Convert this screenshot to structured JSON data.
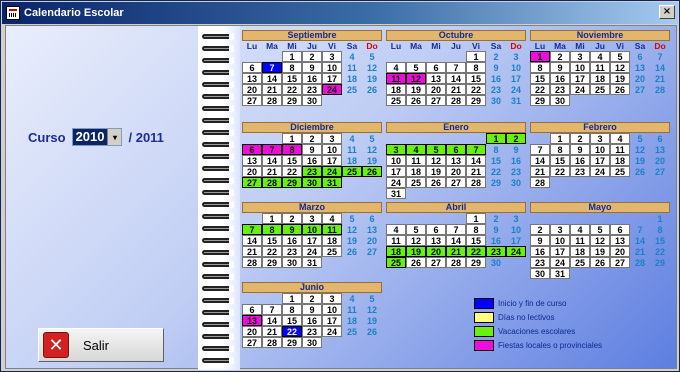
{
  "window": {
    "title": "Calendario Escolar",
    "close_glyph": "×"
  },
  "curso": {
    "label": "Curso",
    "selected": "2010",
    "suffix": "/ 2011",
    "arrow": "▾"
  },
  "salir": {
    "label": "Salir",
    "icon_glyph": "✕"
  },
  "colors": {
    "inicio_fin": "#0000ff",
    "no_lectivo": "#ffff80",
    "vacaciones": "#66f20c",
    "fiestas": "#f20cd9",
    "weekend_text": "#1a80c9"
  },
  "dow": [
    "Lu",
    "Ma",
    "Mi",
    "Ju",
    "Vi",
    "Sa",
    "Do"
  ],
  "months": [
    {
      "name": "Septiembre",
      "weeks": [
        [
          null,
          null,
          "1",
          "2",
          "3",
          "4",
          "5"
        ],
        [
          "6",
          "7",
          "8",
          "9",
          "10",
          "11",
          "12"
        ],
        [
          "13",
          "14",
          "15",
          "16",
          "17",
          "18",
          "19"
        ],
        [
          "20",
          "21",
          "22",
          "23",
          "24",
          "25",
          "26"
        ],
        [
          "27",
          "28",
          "29",
          "30",
          null,
          null,
          null
        ]
      ],
      "blue": [
        "7"
      ],
      "green": [],
      "pink": [
        "24"
      ]
    },
    {
      "name": "Octubre",
      "weeks": [
        [
          null,
          null,
          null,
          null,
          "1",
          "2",
          "3"
        ],
        [
          "4",
          "5",
          "6",
          "7",
          "8",
          "9",
          "10"
        ],
        [
          "11",
          "12",
          "13",
          "14",
          "15",
          "16",
          "17"
        ],
        [
          "18",
          "19",
          "20",
          "21",
          "22",
          "23",
          "24"
        ],
        [
          "25",
          "26",
          "27",
          "28",
          "29",
          "30",
          "31"
        ]
      ],
      "blue": [],
      "green": [],
      "pink": [
        "11",
        "12"
      ]
    },
    {
      "name": "Noviembre",
      "weeks": [
        [
          "1",
          "2",
          "3",
          "4",
          "5",
          "6",
          "7"
        ],
        [
          "8",
          "9",
          "10",
          "11",
          "12",
          "13",
          "14"
        ],
        [
          "15",
          "16",
          "17",
          "18",
          "19",
          "20",
          "21"
        ],
        [
          "22",
          "23",
          "24",
          "25",
          "26",
          "27",
          "28"
        ],
        [
          "29",
          "30",
          null,
          null,
          null,
          null,
          null
        ]
      ],
      "blue": [],
      "green": [],
      "pink": [
        "1"
      ]
    },
    {
      "name": "Diciembre",
      "weeks": [
        [
          null,
          null,
          "1",
          "2",
          "3",
          "4",
          "5"
        ],
        [
          "6",
          "7",
          "8",
          "9",
          "10",
          "11",
          "12"
        ],
        [
          "13",
          "14",
          "15",
          "16",
          "17",
          "18",
          "19"
        ],
        [
          "20",
          "21",
          "22",
          "23",
          "24",
          "25",
          "26"
        ],
        [
          "27",
          "28",
          "29",
          "30",
          "31",
          null,
          null
        ]
      ],
      "blue": [],
      "green": [
        "23",
        "24",
        "25",
        "26",
        "27",
        "28",
        "29",
        "30",
        "31"
      ],
      "pink": [
        "6",
        "7",
        "8"
      ]
    },
    {
      "name": "Enero",
      "weeks": [
        [
          null,
          null,
          null,
          null,
          null,
          "1",
          "2"
        ],
        [
          "3",
          "4",
          "5",
          "6",
          "7",
          "8",
          "9"
        ],
        [
          "10",
          "11",
          "12",
          "13",
          "14",
          "15",
          "16"
        ],
        [
          "17",
          "18",
          "19",
          "20",
          "21",
          "22",
          "23"
        ],
        [
          "24",
          "25",
          "26",
          "27",
          "28",
          "29",
          "30"
        ],
        [
          "31",
          null,
          null,
          null,
          null,
          null,
          null
        ]
      ],
      "blue": [],
      "green": [
        "1",
        "2",
        "3",
        "4",
        "5",
        "6",
        "7"
      ],
      "pink": []
    },
    {
      "name": "Febrero",
      "weeks": [
        [
          null,
          "1",
          "2",
          "3",
          "4",
          "5",
          "6"
        ],
        [
          "7",
          "8",
          "9",
          "10",
          "11",
          "12",
          "13"
        ],
        [
          "14",
          "15",
          "16",
          "17",
          "18",
          "19",
          "20"
        ],
        [
          "21",
          "22",
          "23",
          "24",
          "25",
          "26",
          "27"
        ],
        [
          "28",
          null,
          null,
          null,
          null,
          null,
          null
        ]
      ],
      "blue": [],
      "green": [],
      "pink": []
    },
    {
      "name": "Marzo",
      "weeks": [
        [
          null,
          "1",
          "2",
          "3",
          "4",
          "5",
          "6"
        ],
        [
          "7",
          "8",
          "9",
          "10",
          "11",
          "12",
          "13"
        ],
        [
          "14",
          "15",
          "16",
          "17",
          "18",
          "19",
          "20"
        ],
        [
          "21",
          "22",
          "23",
          "24",
          "25",
          "26",
          "27"
        ],
        [
          "28",
          "29",
          "30",
          "31",
          null,
          null,
          null
        ]
      ],
      "blue": [],
      "green": [
        "7",
        "8",
        "9",
        "10",
        "11"
      ],
      "pink": []
    },
    {
      "name": "Abril",
      "weeks": [
        [
          null,
          null,
          null,
          null,
          "1",
          "2",
          "3"
        ],
        [
          "4",
          "5",
          "6",
          "7",
          "8",
          "9",
          "10"
        ],
        [
          "11",
          "12",
          "13",
          "14",
          "15",
          "16",
          "17"
        ],
        [
          "18",
          "19",
          "20",
          "21",
          "22",
          "23",
          "24"
        ],
        [
          "25",
          "26",
          "27",
          "28",
          "29",
          "30",
          null
        ]
      ],
      "blue": [],
      "green": [
        "18",
        "19",
        "20",
        "21",
        "22",
        "23",
        "24",
        "25"
      ],
      "pink": []
    },
    {
      "name": "Mayo",
      "weeks": [
        [
          null,
          null,
          null,
          null,
          null,
          null,
          "1"
        ],
        [
          "2",
          "3",
          "4",
          "5",
          "6",
          "7",
          "8"
        ],
        [
          "9",
          "10",
          "11",
          "12",
          "13",
          "14",
          "15"
        ],
        [
          "16",
          "17",
          "18",
          "19",
          "20",
          "21",
          "22"
        ],
        [
          "23",
          "24",
          "25",
          "26",
          "27",
          "28",
          "29"
        ],
        [
          "30",
          "31",
          null,
          null,
          null,
          null,
          null
        ]
      ],
      "blue": [],
      "green": [],
      "pink": []
    },
    {
      "name": "Junio",
      "weeks": [
        [
          null,
          null,
          "1",
          "2",
          "3",
          "4",
          "5"
        ],
        [
          "6",
          "7",
          "8",
          "9",
          "10",
          "11",
          "12"
        ],
        [
          "13",
          "14",
          "15",
          "16",
          "17",
          "18",
          "19"
        ],
        [
          "20",
          "21",
          "22",
          "23",
          "24",
          "25",
          "26"
        ],
        [
          "27",
          "28",
          "29",
          "30",
          null,
          null,
          null
        ]
      ],
      "blue": [
        "22"
      ],
      "green": [],
      "pink": [
        "13"
      ]
    }
  ],
  "legend": [
    {
      "label": "Inicio y fin de curso",
      "color": "#0000ff"
    },
    {
      "label": "Días no lectivos",
      "color": "#ffff80"
    },
    {
      "label": "Vacaciones escolares",
      "color": "#66f20c"
    },
    {
      "label": "Fiestas locales o provinciales",
      "color": "#f20cd9"
    }
  ]
}
